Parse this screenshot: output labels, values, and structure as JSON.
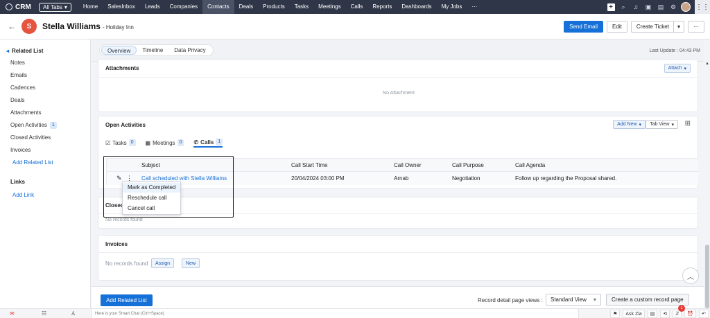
{
  "topbar": {
    "brand": "CRM",
    "all_tabs": "All Tabs",
    "nav": [
      "Home",
      "SalesInbox",
      "Leads",
      "Companies",
      "Contacts",
      "Deals",
      "Products",
      "Tasks",
      "Meetings",
      "Calls",
      "Reports",
      "Dashboards",
      "My Jobs",
      "···"
    ],
    "active_nav": "Contacts"
  },
  "header": {
    "avatar_letter": "S",
    "name": "Stella Williams",
    "subtitle": "- Holiday Inn",
    "send_email": "Send Email",
    "edit": "Edit",
    "create_ticket": "Create Ticket",
    "more": "···"
  },
  "left": {
    "title": "Related List",
    "items": [
      "Notes",
      "Emails",
      "Cadences",
      "Deals",
      "Attachments",
      "Open Activities",
      "Closed Activities",
      "Invoices"
    ],
    "open_activities_count": "1",
    "add_related": "Add Related List",
    "links_title": "Links",
    "add_link": "Add Link"
  },
  "tabs": {
    "items": [
      "Overview",
      "Timeline",
      "Data Privacy"
    ],
    "last_update": "Last Update : 04:43 PM"
  },
  "attachments": {
    "title": "Attachments",
    "attach_btn": "Attach",
    "empty": "No Attachment"
  },
  "open_activities": {
    "title": "Open Activities",
    "add_new": "Add New",
    "tab_view": "Tab View",
    "subtabs": [
      {
        "label": "Tasks",
        "count": "0"
      },
      {
        "label": "Meetings",
        "count": "0"
      },
      {
        "label": "Calls",
        "count": "1"
      }
    ],
    "columns": [
      "Subject",
      "Call Start Time",
      "Call Owner",
      "Call Purpose",
      "Call Agenda"
    ],
    "row": {
      "subject": "Call scheduled with Stella Williams",
      "start_time": "20/04/2024 03:00 PM",
      "owner": "Arnab",
      "purpose": "Negotiation",
      "agenda": "Follow up regarding the Proposal shared."
    }
  },
  "context_menu": {
    "items": [
      "Mark as Completed",
      "Reschedule call",
      "Cancel call"
    ]
  },
  "closed_activities": {
    "title": "Closed",
    "empty": "No records found"
  },
  "invoices": {
    "title": "Invoices",
    "empty": "No records found",
    "assign": "Assign",
    "new": "New"
  },
  "bottom": {
    "add_related": "Add Related List",
    "views_label": "Record detail page views :",
    "view_value": "Standard View",
    "custom_page": "Create a custom record page"
  },
  "statusbar": {
    "chat_placeholder": "Here is your Smart Chat (Ctrl+Space)",
    "ask_zia": "Ask Zia",
    "notif_count": "1"
  }
}
